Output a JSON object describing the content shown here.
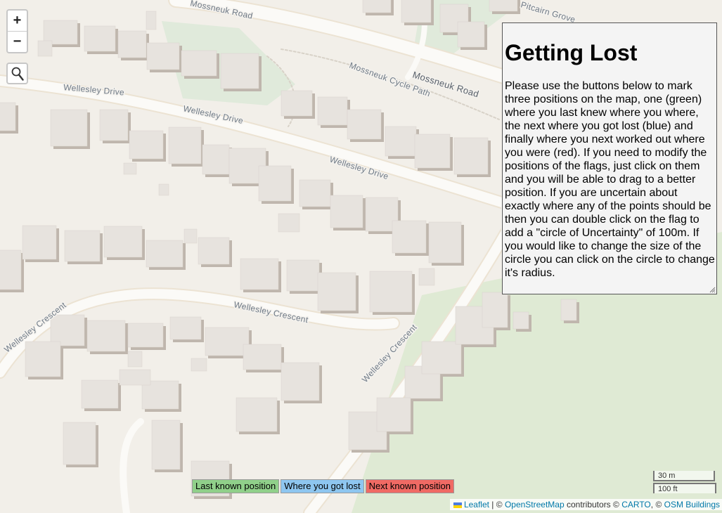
{
  "map": {
    "road_labels": {
      "mossneuk_road_top": "Mossneuk Road",
      "mossneuk_road_right": "Mossneuk Road",
      "mossneuk_cycle_path": "Mossneuk Cycle Path",
      "wellesley_drive_1": "Wellesley Drive",
      "wellesley_drive_2": "Wellesley Drive",
      "wellesley_drive_3": "Wellesley Drive",
      "wellesley_crescent_left": "Wellesley Crescent",
      "wellesley_crescent_mid": "Wellesley Crescent",
      "wellesley_crescent_diag": "Wellesley Crescent",
      "pitcairn_grove": "Pitcairn Grove"
    },
    "colors": {
      "land": "#f2efe9",
      "green": "#dfead4",
      "road": "#fbfaf7",
      "road_edge": "#ece3d3",
      "building": "#e7e3de",
      "building_side": "#bfb6ad"
    }
  },
  "controls": {
    "zoom_in": "+",
    "zoom_out": "−",
    "search_icon": "magnifier-icon"
  },
  "panel": {
    "title": "Getting Lost",
    "body": "Please use the buttons below to mark three positions on the map, one (green) where you last knew where you where, the next where you got lost (blue) and finally where you next worked out where you were (red). If you need to modify the positions of the flags, just click on them and you will be able to drag to a better position. If you are uncertain about exactly where any of the points should be then you can double click on the flag to add a \"circle of Uncertainty\" of 100m. If you would like to change the size of the circle you can click on the circle to change it's radius."
  },
  "buttons": {
    "last_known": {
      "label": "Last known position",
      "color": "#90d08a"
    },
    "got_lost": {
      "label": "Where you got lost",
      "color": "#8ec6f0"
    },
    "next_known": {
      "label": "Next known position",
      "color": "#f06a64"
    }
  },
  "scale": {
    "metric": "30 m",
    "imperial": "100 ft"
  },
  "attribution": {
    "leaflet": "Leaflet",
    "sep1": " | © ",
    "osm": "OpenStreetMap",
    "contributors": " contributors © ",
    "carto": "CARTO",
    "sep2": ", © ",
    "osm_buildings": "OSM Buildings"
  }
}
